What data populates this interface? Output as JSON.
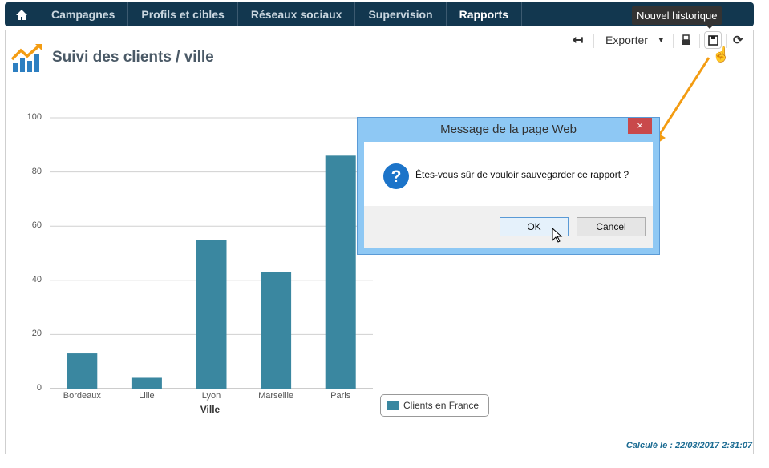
{
  "nav": {
    "items": [
      "Campagnes",
      "Profils et cibles",
      "Réseaux sociaux",
      "Supervision",
      "Rapports"
    ],
    "active": "Rapports"
  },
  "page": {
    "title": "Suivi des clients / ville",
    "export_label": "Exporter",
    "tooltip": "Nouvel historique",
    "footer": "Calculé le : 22/03/2017 2:31:07"
  },
  "dialog": {
    "caption": "Message de la page Web",
    "close": "×",
    "message": "Êtes-vous sûr de vouloir sauvegarder ce rapport ?",
    "ok": "OK",
    "cancel": "Cancel"
  },
  "colors": {
    "nav": "#12374f",
    "bar": "#3a87a0",
    "arrow": "#f39c12"
  },
  "chart_data": {
    "type": "bar",
    "categories": [
      "Bordeaux",
      "Lille",
      "Lyon",
      "Marseille",
      "Paris"
    ],
    "values": [
      13,
      4,
      55,
      43,
      86
    ],
    "xlabel": "Ville",
    "ylabel": "",
    "ylim": [
      0,
      100
    ],
    "yticks": [
      "0",
      "20",
      "40",
      "60",
      "80",
      "100"
    ],
    "legend": "Clients en France",
    "legend_position": "bottom-right",
    "grid": true
  }
}
